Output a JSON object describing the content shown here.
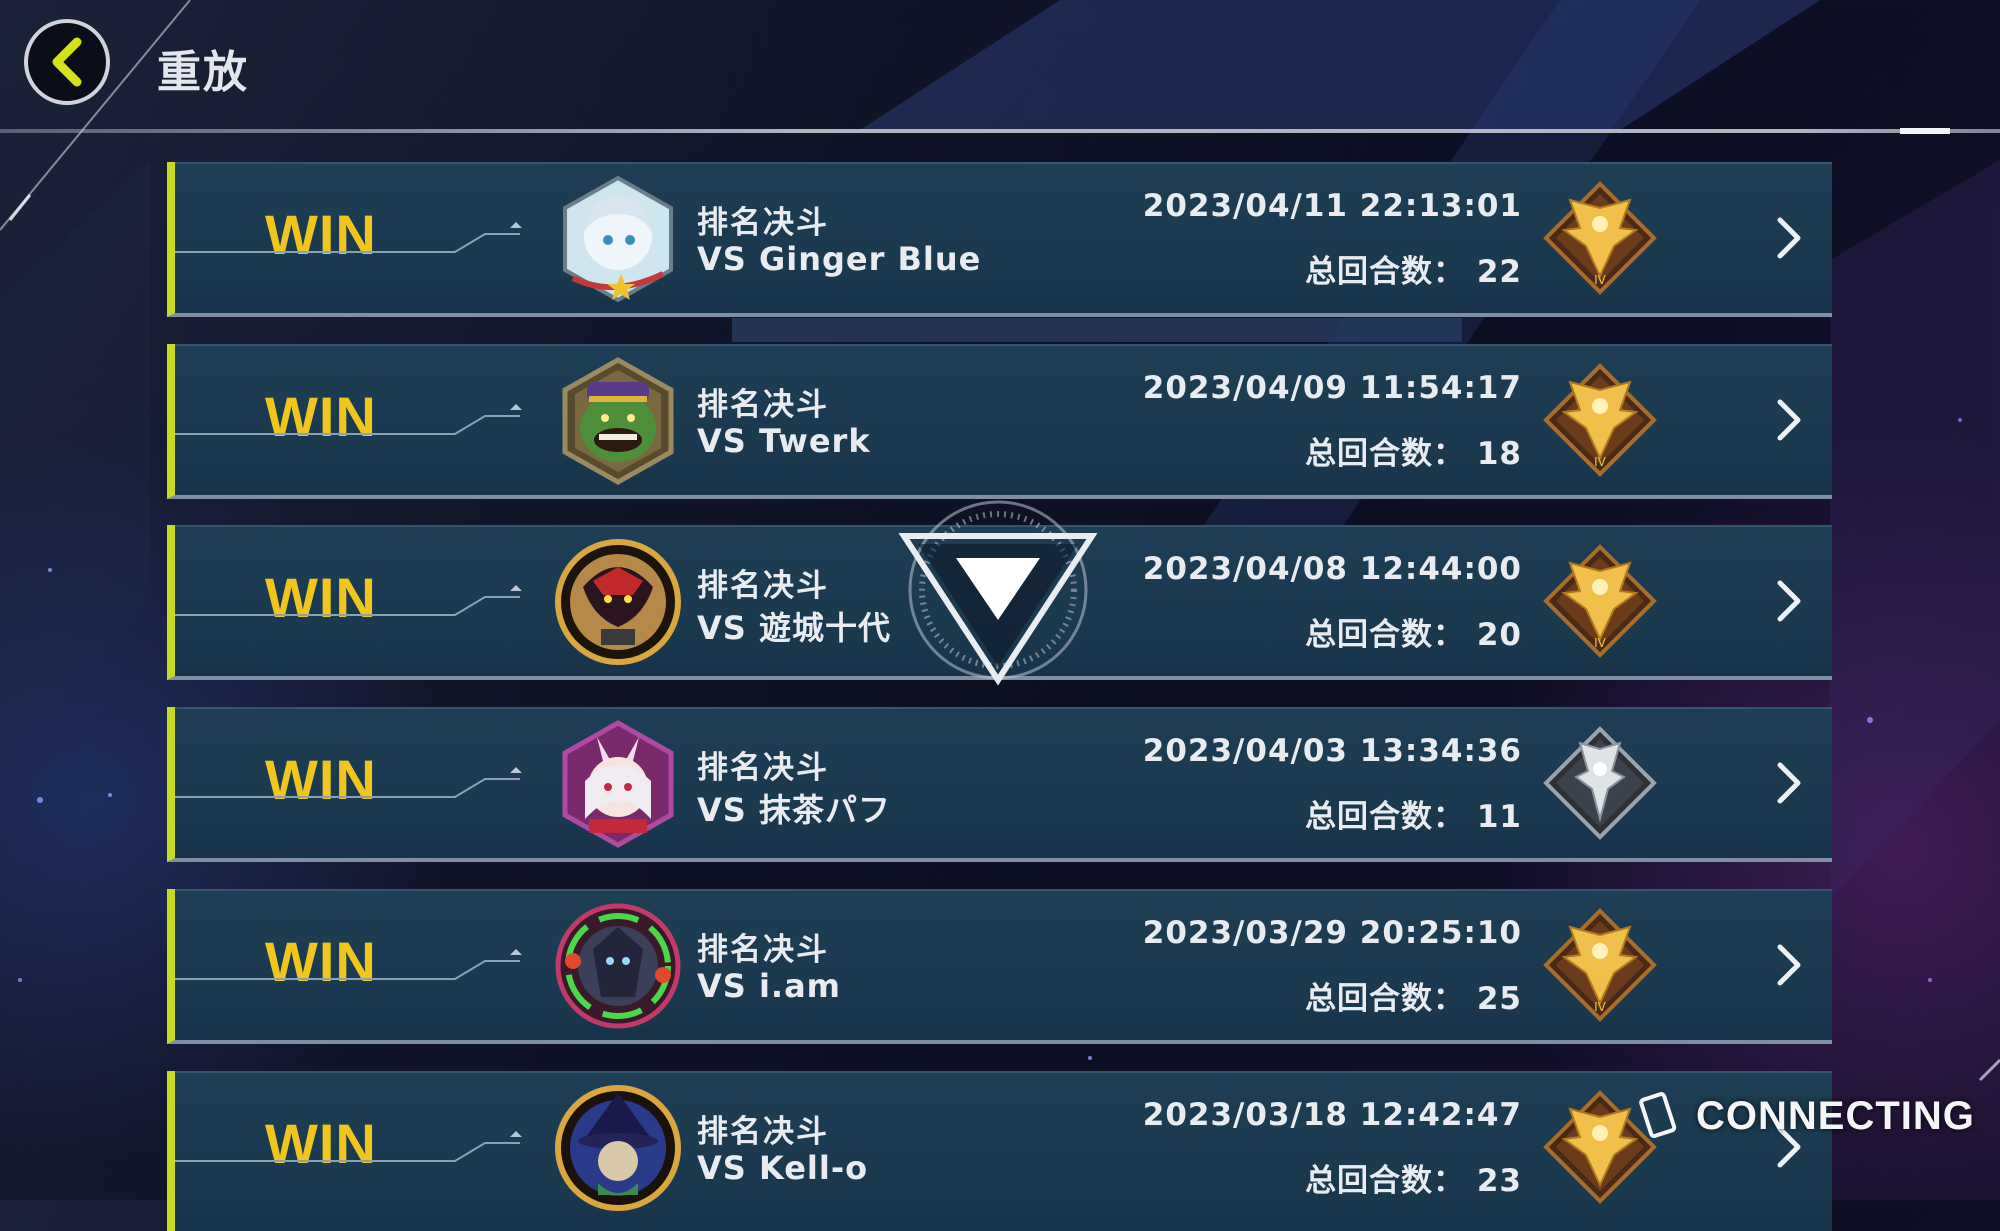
{
  "header": {
    "title": "重放",
    "back_icon": "chevron-left-icon"
  },
  "colors": {
    "accent_win_bar": "#c7dc1f",
    "win_text": "#f0c61c",
    "row_bg": "#1d3e55",
    "back_arrow": "#d4e21a"
  },
  "replays": [
    {
      "result": "WIN",
      "mode": "排名决斗",
      "opponent": "VS Ginger Blue",
      "datetime": "2023/04/11 22:13:01",
      "turns_label": "总回合数：",
      "turns": "22",
      "avatar_icon": "white-haired-character-avatar-icon",
      "rank_icon": "gold-rank-emblem-icon"
    },
    {
      "result": "WIN",
      "mode": "排名决斗",
      "opponent": "VS Twerk",
      "datetime": "2023/04/09 11:54:17",
      "turns_label": "总回合数：",
      "turns": "18",
      "avatar_icon": "green-goblin-avatar-icon",
      "rank_icon": "gold-rank-emblem-icon"
    },
    {
      "result": "WIN",
      "mode": "排名决斗",
      "opponent": "VS 遊城十代",
      "datetime": "2023/04/08 12:44:00",
      "turns_label": "总回合数：",
      "turns": "20",
      "avatar_icon": "dark-hero-avatar-icon",
      "rank_icon": "gold-rank-emblem-icon"
    },
    {
      "result": "WIN",
      "mode": "排名决斗",
      "opponent": "VS 抹茶パフ",
      "datetime": "2023/04/03 13:34:36",
      "turns_label": "总回合数：",
      "turns": "11",
      "avatar_icon": "bunny-girl-avatar-icon",
      "rank_icon": "silver-rank-emblem-icon"
    },
    {
      "result": "WIN",
      "mode": "排名决斗",
      "opponent": "VS i.am",
      "datetime": "2023/03/29 20:25:10",
      "turns_label": "总回合数：",
      "turns": "25",
      "avatar_icon": "dark-warrior-avatar-icon",
      "rank_icon": "gold-rank-emblem-icon"
    },
    {
      "result": "WIN",
      "mode": "排名决斗",
      "opponent": "VS Kell-o",
      "datetime": "2023/03/18 12:42:47",
      "turns_label": "总回合数：",
      "turns": "23",
      "avatar_icon": "dark-magician-avatar-icon",
      "rank_icon": "gold-rank-emblem-icon"
    }
  ],
  "status": {
    "connecting_text": "CONNECTING",
    "connecting_icon": "card-icon",
    "loading_icon": "loading-triangle-icon"
  }
}
